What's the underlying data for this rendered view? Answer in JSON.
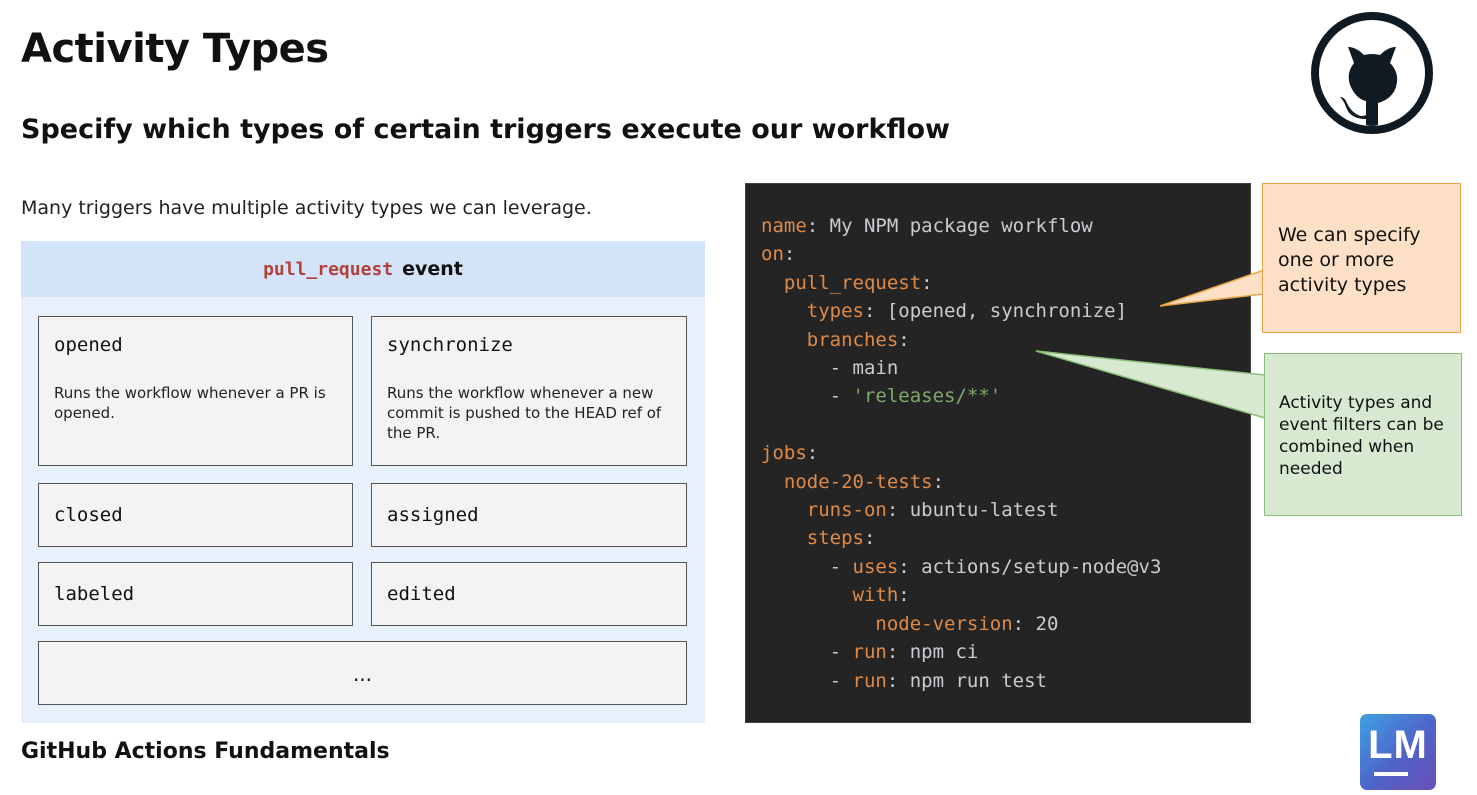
{
  "slide": {
    "title": "Activity Types",
    "subtitle": "Specify which types of certain triggers execute our workflow",
    "intro": "Many triggers have multiple activity types we can leverage.",
    "footer": "GitHub Actions Fundamentals"
  },
  "event_panel": {
    "event_code": "pull_request",
    "event_word": "event",
    "cards": [
      {
        "name": "opened",
        "description": "Runs the workflow whenever a PR is opened."
      },
      {
        "name": "synchronize",
        "description": "Runs the workflow whenever a new commit is pushed to the HEAD ref of the PR."
      },
      {
        "name": "closed"
      },
      {
        "name": "assigned"
      },
      {
        "name": "labeled"
      },
      {
        "name": "edited"
      }
    ],
    "more": "..."
  },
  "code": {
    "lines": [
      [
        {
          "t": "name",
          "c": "k"
        },
        {
          "t": ": My NPM package workflow"
        }
      ],
      [
        {
          "t": "on",
          "c": "k"
        },
        {
          "t": ":"
        }
      ],
      [
        {
          "t": "  "
        },
        {
          "t": "pull_request",
          "c": "k"
        },
        {
          "t": ":"
        }
      ],
      [
        {
          "t": "    "
        },
        {
          "t": "types",
          "c": "k"
        },
        {
          "t": ": [opened, synchronize]"
        }
      ],
      [
        {
          "t": "    "
        },
        {
          "t": "branches",
          "c": "k"
        },
        {
          "t": ":"
        }
      ],
      [
        {
          "t": "      - main"
        }
      ],
      [
        {
          "t": "      - "
        },
        {
          "t": "'releases/**'",
          "c": "s"
        }
      ],
      [
        {
          "t": ""
        }
      ],
      [
        {
          "t": "jobs",
          "c": "k"
        },
        {
          "t": ":"
        }
      ],
      [
        {
          "t": "  "
        },
        {
          "t": "node-20-tests",
          "c": "k"
        },
        {
          "t": ":"
        }
      ],
      [
        {
          "t": "    "
        },
        {
          "t": "runs-on",
          "c": "k"
        },
        {
          "t": ": ubuntu-latest"
        }
      ],
      [
        {
          "t": "    "
        },
        {
          "t": "steps",
          "c": "k"
        },
        {
          "t": ":"
        }
      ],
      [
        {
          "t": "      - "
        },
        {
          "t": "uses",
          "c": "k"
        },
        {
          "t": ": actions/setup-node@v3"
        }
      ],
      [
        {
          "t": "        "
        },
        {
          "t": "with",
          "c": "k"
        },
        {
          "t": ":"
        }
      ],
      [
        {
          "t": "          "
        },
        {
          "t": "node-version",
          "c": "k"
        },
        {
          "t": ": 20"
        }
      ],
      [
        {
          "t": "      - "
        },
        {
          "t": "run",
          "c": "k"
        },
        {
          "t": ": npm ci"
        }
      ],
      [
        {
          "t": "      - "
        },
        {
          "t": "run",
          "c": "k"
        },
        {
          "t": ": npm run test"
        }
      ]
    ]
  },
  "callouts": {
    "orange": "We can specify one or more activity types",
    "green": "Activity types and event filters can be combined when needed"
  },
  "logos": {
    "github": "github-octocat-icon",
    "lm_text": "LM"
  },
  "colors": {
    "code_key": "#e08a46",
    "code_string": "#7fa86a",
    "code_bg": "#242424",
    "event_code": "#b4403c",
    "callout_orange": "#fde0c6",
    "callout_green": "#d7e9d1"
  }
}
